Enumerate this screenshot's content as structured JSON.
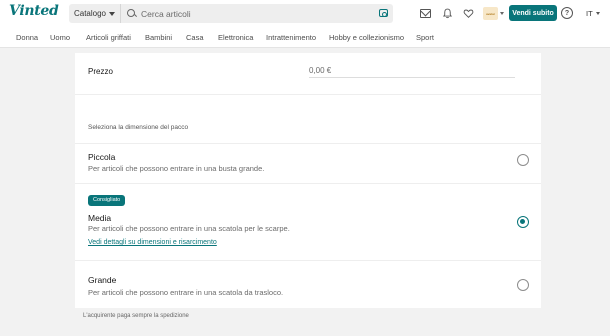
{
  "header": {
    "logo": "Vinted",
    "catalog_label": "Catalogo",
    "search_placeholder": "Cerca articoli",
    "avatar_text": "avatar",
    "sell_button": "Vendi subito",
    "help_glyph": "?",
    "language": "IT",
    "icons": [
      "search-icon",
      "camera-icon",
      "mail-icon",
      "bell-icon",
      "heart-icon",
      "help-icon"
    ]
  },
  "categories": [
    "Donna",
    "Uomo",
    "Articoli griffati",
    "Bambini",
    "Casa",
    "Elettronica",
    "Intrattenimento",
    "Hobby e collezionismo",
    "Sport"
  ],
  "form": {
    "price_label": "Prezzo",
    "price_value": "0,00 €",
    "package_title": "Seleziona la dimensione del pacco",
    "options": [
      {
        "title": "Piccola",
        "description": "Per articoli che possono entrare in una busta grande.",
        "selected": false
      },
      {
        "badge": "Consigliato",
        "title": "Media",
        "description": "Per articoli che possono entrare in una scatola per le scarpe.",
        "link": "Vedi dettagli su dimensioni e risarcimento",
        "selected": true
      },
      {
        "title": "Grande",
        "description": "Per articoli che possono entrare in una scatola da trasloco.",
        "selected": false
      }
    ],
    "footnote": "L'acquirente paga sempre la spedizione"
  },
  "colors": {
    "brand": "#09757a",
    "background": "#f2f2f2"
  }
}
